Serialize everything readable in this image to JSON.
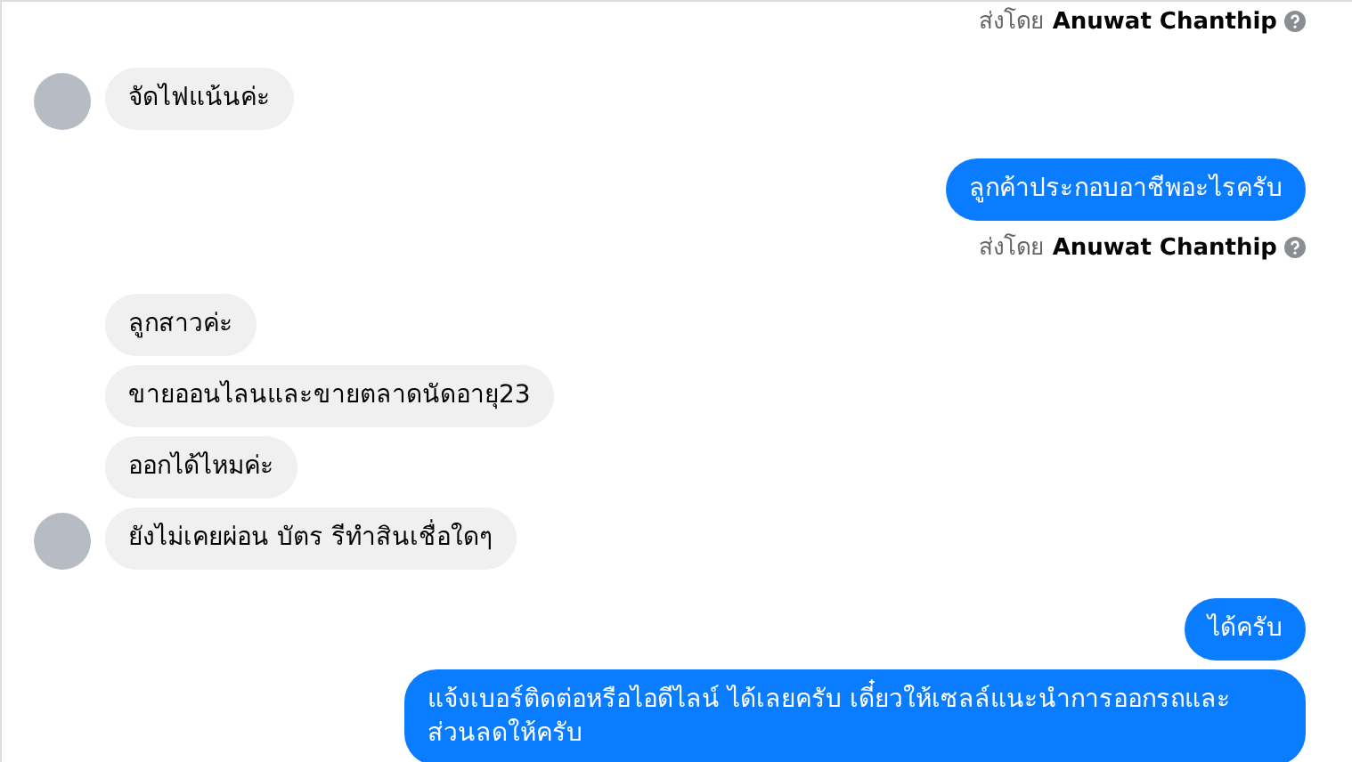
{
  "messages": [
    {
      "kind": "sender_note",
      "prefix": "ส่งโดย",
      "name": "Anuwat Chanthip"
    },
    {
      "kind": "incoming",
      "text": "จัดไฟแน้นค่ะ",
      "avatar": true
    },
    {
      "kind": "outgoing",
      "text": "ลูกค้าประกอบอาชีพอะไรครับ"
    },
    {
      "kind": "sender_note",
      "prefix": "ส่งโดย",
      "name": "Anuwat Chanthip"
    },
    {
      "kind": "incoming",
      "text": "ลูกสาวค่ะ",
      "avatar": false
    },
    {
      "kind": "incoming",
      "text": "ขายออนไลนและขายตลาดนัดอายุ23",
      "avatar": false
    },
    {
      "kind": "incoming",
      "text": "ออกได้ไหมค่ะ",
      "avatar": false
    },
    {
      "kind": "incoming",
      "text": "ยังไม่เคยผ่อน บัตร รีทำสินเชื่อใดๆ",
      "avatar": true
    },
    {
      "kind": "outgoing",
      "text": "ได้ครับ"
    },
    {
      "kind": "outgoing",
      "text": "แจ้งเบอร์ติดต่อหรือไอดีไลน์ ได้เลยครับ เดี๋ยวให้เซลล์แนะนำการออกรถและ ส่วนลดให้ครับ"
    }
  ]
}
